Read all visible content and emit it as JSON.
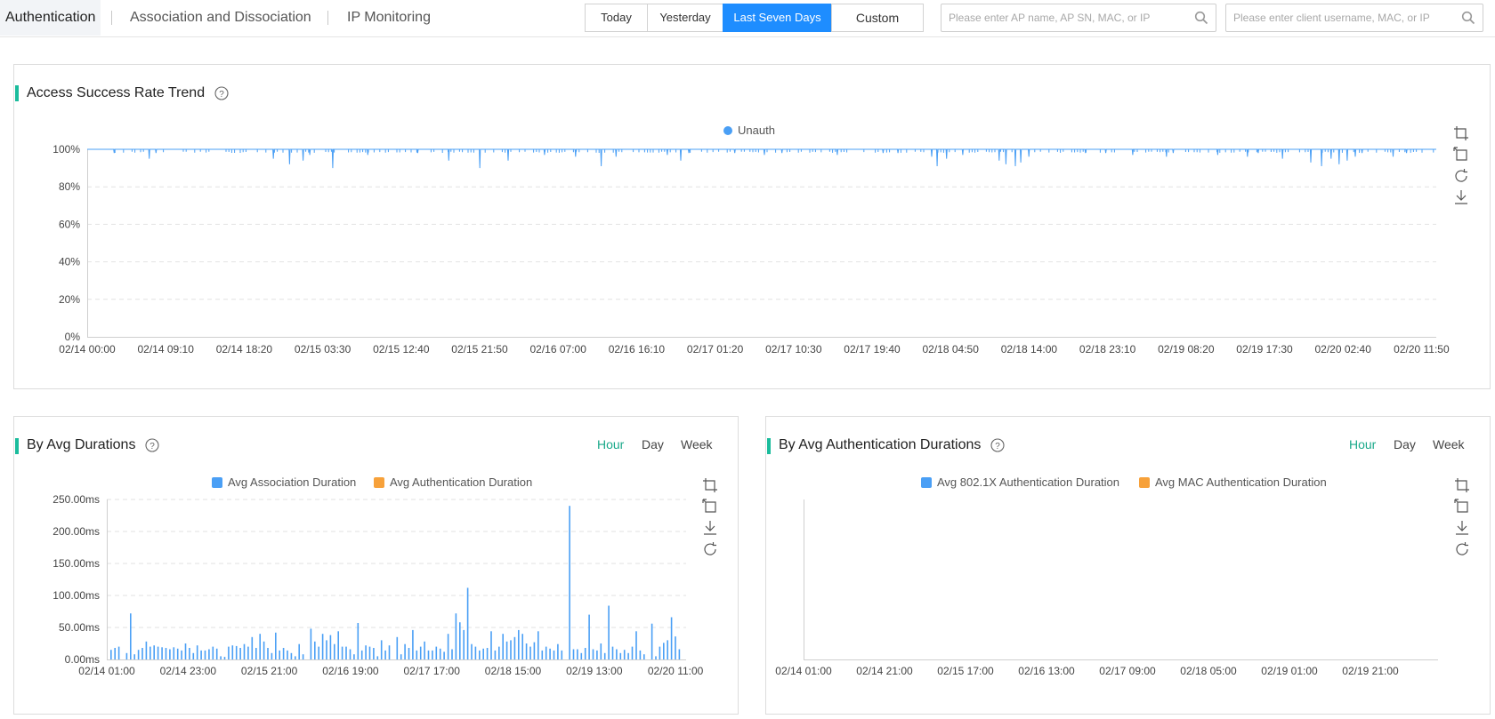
{
  "tabs": [
    {
      "label": "Authentication",
      "active": true
    },
    {
      "label": "Association and Dissociation",
      "active": false
    },
    {
      "label": "IP Monitoring",
      "active": false
    }
  ],
  "time_filter": {
    "today": "Today",
    "yesterday": "Yesterday",
    "last_seven_days": "Last Seven Days",
    "custom": "Custom",
    "selected": "Last Seven Days"
  },
  "search": {
    "ap_placeholder": "Please enter AP name, AP SN, MAC, or IP",
    "client_placeholder": "Please enter client username, MAC, or IP"
  },
  "colors": {
    "accent": "#1e8dff",
    "series_blue": "#4a9ff5",
    "series_orange": "#f7a13a",
    "title_bar": "#1abc9c",
    "period_active": "#1aa98a"
  },
  "trend_panel": {
    "title": "Access Success Rate Trend",
    "help_icon": "question-circle-icon",
    "legend": "Unauth",
    "toolbox": [
      "zoom-icon",
      "zoom-reset-icon",
      "restore-icon",
      "download-icon"
    ]
  },
  "durations_panel": {
    "title": "By Avg Durations",
    "periods": [
      "Hour",
      "Day",
      "Week"
    ],
    "active_period": "Hour",
    "legend": [
      "Avg Association Duration",
      "Avg Authentication Duration"
    ],
    "toolbox": [
      "zoom-icon",
      "zoom-reset-icon",
      "download-icon",
      "restore-icon"
    ]
  },
  "auth_panel": {
    "title": "By Avg Authentication Durations",
    "periods": [
      "Hour",
      "Day",
      "Week"
    ],
    "active_period": "Hour",
    "legend": [
      "Avg 802.1X Authentication Duration",
      "Avg MAC Authentication Duration"
    ],
    "toolbox": [
      "zoom-icon",
      "zoom-reset-icon",
      "download-icon",
      "restore-icon"
    ]
  },
  "chart_data": [
    {
      "type": "line",
      "title": "Access Success Rate Trend",
      "series": [
        {
          "name": "Unauth",
          "color": "#4a9ff5",
          "note_values": "mostly 100% with frequent brief dips, most between 91% and 99%"
        }
      ],
      "y_ticks": [
        "0%",
        "20%",
        "40%",
        "60%",
        "80%",
        "100%"
      ],
      "ylim": [
        0,
        100
      ],
      "x_ticks": [
        "02/14 00:00",
        "02/14 09:10",
        "02/14 18:20",
        "02/15 03:30",
        "02/15 12:40",
        "02/15 21:50",
        "02/16 07:00",
        "02/16 16:10",
        "02/17 01:20",
        "02/17 10:30",
        "02/17 19:40",
        "02/18 04:50",
        "02/18 14:00",
        "02/18 23:10",
        "02/19 08:20",
        "02/19 17:30",
        "02/20 02:40",
        "02/20 11:50"
      ],
      "dips": [
        [
          0.02,
          98
        ],
        [
          0.046,
          95
        ],
        [
          0.051,
          98
        ],
        [
          0.138,
          95
        ],
        [
          0.15,
          92
        ],
        [
          0.16,
          94
        ],
        [
          0.165,
          97
        ],
        [
          0.182,
          90
        ],
        [
          0.208,
          97
        ],
        [
          0.245,
          98
        ],
        [
          0.268,
          94
        ],
        [
          0.291,
          90
        ],
        [
          0.312,
          94
        ],
        [
          0.339,
          97
        ],
        [
          0.362,
          96
        ],
        [
          0.381,
          91
        ],
        [
          0.392,
          96
        ],
        [
          0.43,
          97
        ],
        [
          0.44,
          94
        ],
        [
          0.446,
          98
        ],
        [
          0.48,
          98
        ],
        [
          0.502,
          97
        ],
        [
          0.515,
          98
        ],
        [
          0.556,
          97
        ],
        [
          0.59,
          98
        ],
        [
          0.601,
          98
        ],
        [
          0.626,
          96
        ],
        [
          0.63,
          91
        ],
        [
          0.637,
          95
        ],
        [
          0.649,
          97
        ],
        [
          0.676,
          94
        ],
        [
          0.681,
          92
        ],
        [
          0.688,
          91
        ],
        [
          0.692,
          93
        ],
        [
          0.698,
          96
        ],
        [
          0.74,
          98
        ],
        [
          0.755,
          98
        ],
        [
          0.775,
          97
        ],
        [
          0.8,
          96
        ],
        [
          0.805,
          98
        ],
        [
          0.838,
          97
        ],
        [
          0.86,
          96
        ],
        [
          0.868,
          98
        ],
        [
          0.886,
          95
        ],
        [
          0.907,
          93
        ],
        [
          0.915,
          91
        ],
        [
          0.922,
          95
        ],
        [
          0.928,
          92
        ],
        [
          0.934,
          94
        ],
        [
          0.94,
          96
        ],
        [
          0.945,
          98
        ],
        [
          0.968,
          96
        ],
        [
          0.978,
          98
        ]
      ]
    },
    {
      "type": "bar",
      "title": "By Avg Durations",
      "y_ticks": [
        "0.00ms",
        "50.00ms",
        "100.00ms",
        "150.00ms",
        "200.00ms",
        "250.00ms"
      ],
      "ylim": [
        0,
        250
      ],
      "x_ticks": [
        "02/14 01:00",
        "02/14 23:00",
        "02/15 21:00",
        "02/16 19:00",
        "02/17 17:00",
        "02/18 15:00",
        "02/19 13:00",
        "02/20 11:00"
      ],
      "series": [
        {
          "name": "Avg Association Duration",
          "color": "#4a9ff5",
          "values": [
            15,
            18,
            20,
            0,
            10,
            72,
            8,
            15,
            18,
            28,
            20,
            22,
            20,
            19,
            18,
            16,
            19,
            17,
            14,
            25,
            18,
            10,
            22,
            14,
            14,
            16,
            20,
            17,
            5,
            4,
            20,
            22,
            21,
            18,
            24,
            20,
            35,
            18,
            40,
            28,
            18,
            10,
            42,
            14,
            18,
            14,
            10,
            5,
            24,
            8,
            0,
            48,
            28,
            20,
            40,
            30,
            38,
            24,
            44,
            20,
            20,
            16,
            8,
            57,
            14,
            22,
            20,
            18,
            5,
            30,
            14,
            22,
            0,
            35,
            8,
            24,
            18,
            46,
            14,
            20,
            28,
            14,
            14,
            20,
            17,
            12,
            40,
            16,
            72,
            58,
            46,
            112,
            24,
            20,
            14,
            17,
            18,
            44,
            14,
            20,
            40,
            28,
            30,
            35,
            46,
            40,
            25,
            20,
            27,
            44,
            14,
            20,
            17,
            14,
            24,
            14,
            0,
            240,
            16,
            16,
            10,
            18,
            70,
            16,
            14,
            25,
            10,
            84,
            20,
            16,
            10,
            15,
            10,
            20,
            44,
            14,
            8,
            0,
            56,
            5,
            20,
            26,
            30,
            66,
            36,
            16
          ]
        },
        {
          "name": "Avg Authentication Duration",
          "color": "#f7a13a",
          "values": []
        }
      ]
    },
    {
      "type": "bar",
      "title": "By Avg Authentication Durations",
      "x_ticks": [
        "02/14 01:00",
        "02/14 21:00",
        "02/15 17:00",
        "02/16 13:00",
        "02/17 09:00",
        "02/18 05:00",
        "02/19 01:00",
        "02/19 21:00"
      ],
      "series": [
        {
          "name": "Avg 802.1X Authentication Duration",
          "color": "#4a9ff5",
          "values": []
        },
        {
          "name": "Avg MAC Authentication Duration",
          "color": "#f7a13a",
          "values": []
        }
      ]
    }
  ]
}
